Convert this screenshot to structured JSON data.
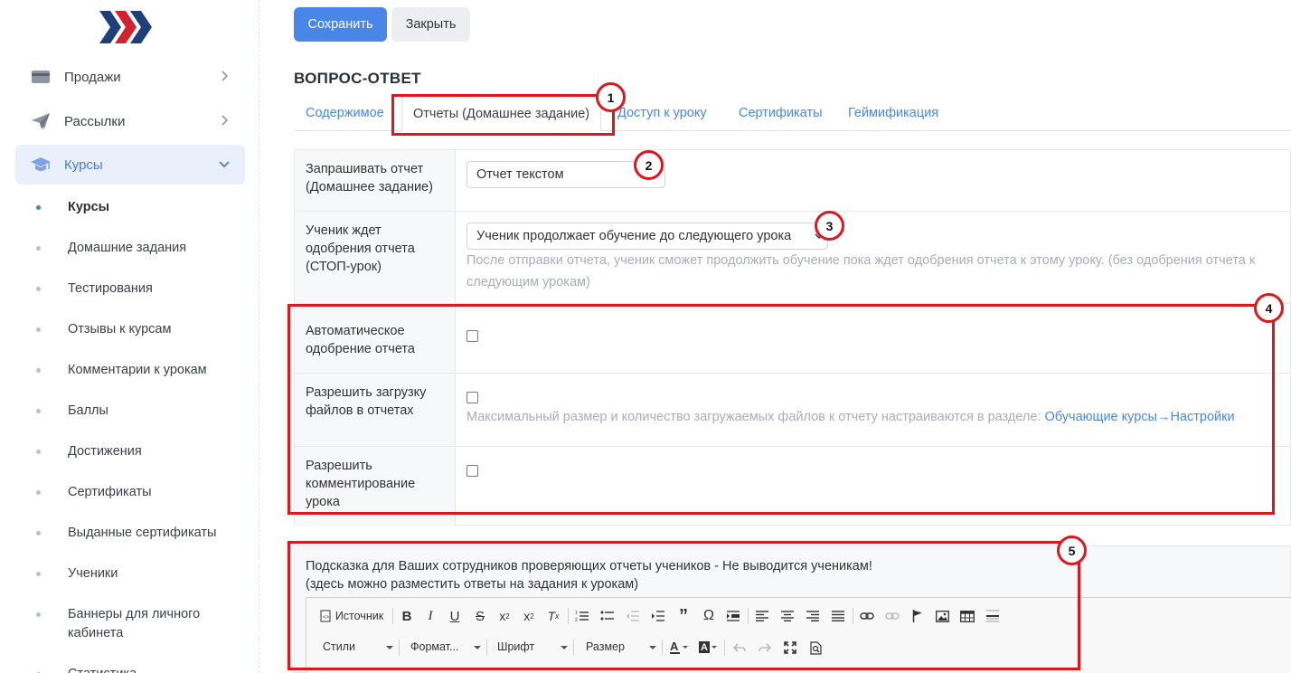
{
  "sidebar": {
    "nav": [
      {
        "label": "Продажи",
        "icon": "wallet-icon"
      },
      {
        "label": "Рассылки",
        "icon": "paper-plane-icon"
      },
      {
        "label": "Курсы",
        "icon": "graduation-cap-icon"
      }
    ],
    "sub_items": [
      "Курсы",
      "Домашние задания",
      "Тестирования",
      "Отзывы к курсам",
      "Комментарии к урокам",
      "Баллы",
      "Достижения",
      "Сертификаты",
      "Выданные сертификаты",
      "Ученики",
      "Баннеры для личного кабинета",
      "Статистика"
    ]
  },
  "toolbar": {
    "save_label": "Сохранить",
    "close_label": "Закрыть"
  },
  "page_title": "ВОПРОС-ОТВЕТ",
  "tabs": [
    "Содержимое",
    "Отчеты (Домашнее задание)",
    "Доступ к уроку",
    "Сертификаты",
    "Геймификация"
  ],
  "form": {
    "request_report": {
      "label": "Запрашивать отчет (Домашнее задание)",
      "value": "Отчет текстом"
    },
    "stop_lesson": {
      "label": "Ученик ждет одобрения отчета (СТОП-урок)",
      "value": "Ученик продолжает обучение до следующего урока",
      "help_line1": "После отправки отчета, ученик сможет продолжить обучение пока ждет одобрения отчета к этому уроку. (без одобрения отчета к",
      "help_line2": "следующим урокам)"
    },
    "auto_approve": {
      "label": "Автоматическое одобрение отчета",
      "checked": false
    },
    "allow_files": {
      "label": "Разрешить загрузку файлов в отчетах",
      "checked": false,
      "help": "Максимальный размер и количество загружаемых файлов к отчету настраиваются в разделе:",
      "help_link": "Обучающие курсы→Настройки"
    },
    "allow_comments": {
      "label": "Разрешить комментирование урока",
      "checked": false
    }
  },
  "hint": {
    "line1": "Подсказка для Ваших сотрудников проверяющих отчеты учеников - Не выводится ученикам!",
    "line2": "(здесь можно разместить ответы на задания к урокам)"
  },
  "editor": {
    "source_label": "Источник",
    "styles_label": "Стили",
    "format_label": "Формат...",
    "font_label": "Шрифт",
    "size_label": "Размер"
  },
  "annotations": [
    "1",
    "2",
    "3",
    "4",
    "5"
  ],
  "colors": {
    "accent": "#4a86e8",
    "highlight": "#e0161f",
    "active_bg": "#eaf0fb"
  }
}
